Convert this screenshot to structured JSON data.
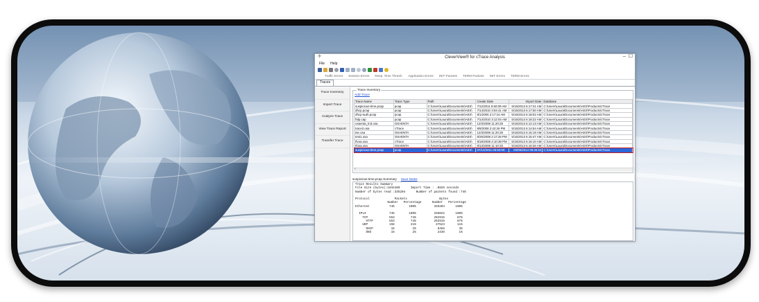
{
  "app": {
    "title": "CleverView® for cTrace Analysis",
    "menu": [
      "File",
      "Help"
    ],
    "error_tabs": [
      "Traffic Errors",
      "Session Errors",
      "Resp. Time Thresh.",
      "Application Errors",
      "INIT Packets",
      "TERM Packets",
      "INIT Errors",
      "TERM Errors"
    ],
    "tab": "Traces"
  },
  "sidebar": {
    "items": [
      "Trace Inventory",
      "Import Trace",
      "Analyze Trace",
      "View Trace Report",
      "Transfer Trace"
    ]
  },
  "inventory": {
    "legend": "Trace Inventory",
    "add_link": "Add Trace",
    "columns": [
      "Trace Name",
      "Trace Type",
      "Path",
      "Create Date",
      "Import Date",
      "Database"
    ],
    "rows": [
      [
        "suspicious-time.pcap",
        "pcap",
        "C:\\Users\\Laura\\Documents\\AES\\",
        "7/12/2011 6:50:09 AM",
        "5/15/2013 6:17:31 AM",
        "C:\\Users\\Laura\\Documents\\AES\\Products\\cTrace"
      ],
      [
        "dhcp.pcap",
        "pcap",
        "C:\\Users\\Laura\\Documents\\AES\\",
        "7/14/2010 3:04:41 AM",
        "5/15/2013 6:17:50 AM",
        "C:\\Users\\Laura\\Documents\\AES\\Products\\cTrace"
      ],
      [
        "dhcp-auth.pcap",
        "pcap",
        "C:\\Users\\Laura\\Documents\\AES\\",
        "8/1/2006 2:17:24 AM",
        "5/15/2013 6:18:02 AM",
        "C:\\Users\\Laura\\Documents\\AES\\Products\\cTrace"
      ],
      [
        "http.cap",
        "pcap",
        "C:\\Users\\Laura\\Documents\\AES\\",
        "7/14/2010 3:12:04 AM",
        "5/15/2013 6:18:22 AM",
        "C:\\Users\\Laura\\Documents\\AES\\Products\\cTrace"
      ],
      [
        "osaenta_tn3.osa",
        "OSAENTA",
        "C:\\Users\\Laura\\Documents\\AES\\",
        "12/3/2008 11:20:28",
        "5/15/2013 6:12:13 AM",
        "C:\\Users\\Laura\\Documents\\AES\\Products\\cTrace"
      ],
      [
        "trace2.osa",
        "cTrace",
        "C:\\Users\\Laura\\Documents\\AES\\",
        "8/8/2008 2:42:26 PM",
        "5/15/2013 6:14:54 AM",
        "C:\\Users\\Laura\\Documents\\AES\\Products\\cTrace"
      ],
      [
        "tse.osa",
        "OSAENTA",
        "C:\\Users\\Laura\\Documents\\AES\\",
        "12/3/2008 11:20:28",
        "5/15/2013 6:15:19 AM",
        "C:\\Users\\Laura\\Documents\\AES\\Products\\cTrace"
      ],
      [
        "test1.osa",
        "OSAENTA",
        "C:\\Users\\Laura\\Documents\\AES\\",
        "8/26/2008 2:17:26 PM",
        "5/15/2013 6:15:47 AM",
        "C:\\Users\\Laura\\Documents\\AES\\Products\\cTrace"
      ],
      [
        "tfvoa.osa",
        "cTrace",
        "C:\\Users\\Laura\\Documents\\AES\\",
        "8/18/2008 2:10:38 PM",
        "5/15/2013 6:16:10 AM",
        "C:\\Users\\Laura\\Documents\\AES\\Products\\cTrace"
      ],
      [
        "tfosa.osa",
        "OSAENTA",
        "C:\\Users\\Laura\\Documents\\AES\\",
        "9/13/2008 11:10:33",
        "5/15/2013 6:16:26 AM",
        "C:\\Users\\Laura\\Documents\\AES\\Products\\cTrace"
      ],
      [
        "suspicious-time.pcap",
        "pcap",
        "C:\\Users\\Laura\\Documents\\AES\\",
        "07/12/2011 06:50:09",
        "03/05/2014 08:36:52",
        "C:\\Users\\Laura\\Documents\\AES\\Products\\cTrace"
      ]
    ],
    "selected_row": 10
  },
  "summary": {
    "tab_label": "suspicious-time.pcap Summary",
    "save_link": "Save Notes",
    "lines": [
      "Trace Results Summary",
      "File Size (bytes):1044480      Import Time : .0826 seconds",
      "Number of bytes read :335204      Number of packets found :745",
      "",
      "Protocol              Packets                  Bytes",
      "                  Number   Percentage      Number   Percentage",
      "Ethernet           745        100%          335204      100%",
      "",
      "  IPv4             745        100%          335022      100%",
      "    TCP            553         74%          292915       87%",
      "      HTTP         553         74%          292915       87%",
      "    UDP            156         21%           37523       11%",
      "      DHCP          16          2%            8456        3%",
      "      DNS           15          2%            2436        1%"
    ]
  },
  "colors": {
    "selection": "#2c66d9",
    "selection_outline": "#c61a1a",
    "link": "#1a4fd6",
    "frame": "#0c0c0c"
  }
}
